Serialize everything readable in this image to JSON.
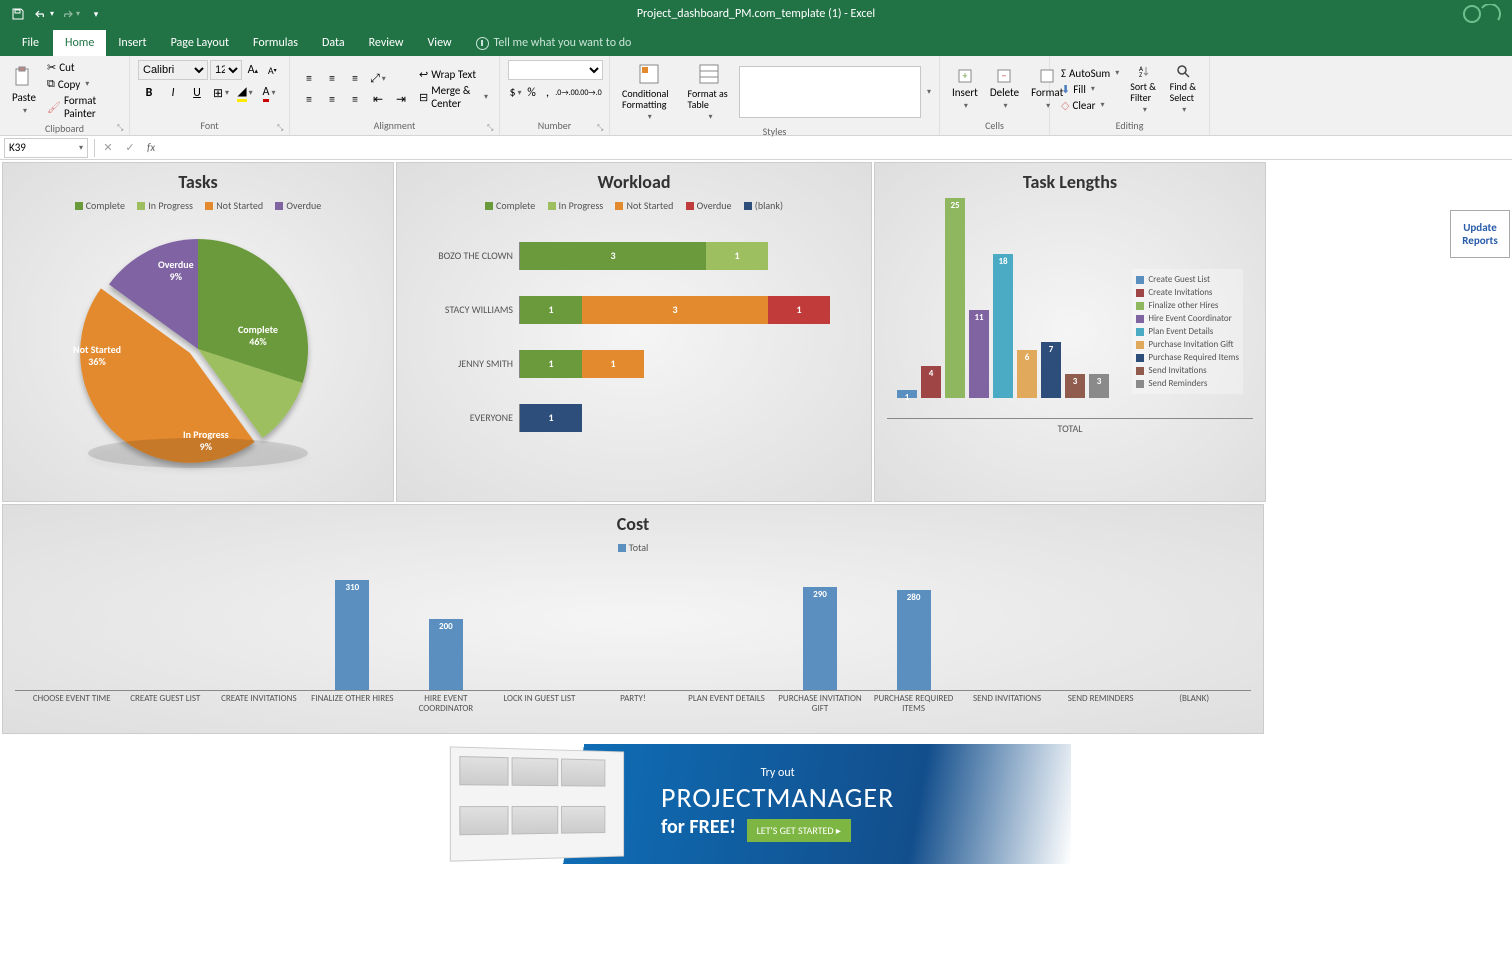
{
  "app": {
    "title": "Project_dashboard_PM.com_template (1) - Excel"
  },
  "tabs": [
    "File",
    "Home",
    "Insert",
    "Page Layout",
    "Formulas",
    "Data",
    "Review",
    "View"
  ],
  "tellme": "Tell me what you want to do",
  "ribbon": {
    "clipboard": {
      "label": "Clipboard",
      "paste": "Paste",
      "cut": "Cut",
      "copy": "Copy",
      "painter": "Format Painter"
    },
    "font": {
      "label": "Font",
      "name": "Calibri",
      "size": "12",
      "bold": "B",
      "italic": "I",
      "underline": "U"
    },
    "alignment": {
      "label": "Alignment",
      "wrap": "Wrap Text",
      "merge": "Merge & Center"
    },
    "number": {
      "label": "Number"
    },
    "styles": {
      "label": "Styles",
      "conditional": "Conditional Formatting",
      "table": "Format as Table"
    },
    "cells": {
      "label": "Cells",
      "insert": "Insert",
      "delete": "Delete",
      "format": "Format"
    },
    "editing": {
      "label": "Editing",
      "autosum": "AutoSum",
      "fill": "Fill",
      "clear": "Clear",
      "sort": "Sort & Filter",
      "find": "Find & Select"
    }
  },
  "formula": {
    "cell": "K39"
  },
  "update_btn": "Update Reports",
  "chart_data": [
    {
      "type": "pie",
      "title": "Tasks",
      "series": [
        {
          "name": "Complete",
          "value": 46,
          "color": "#6a9a3b"
        },
        {
          "name": "In Progress",
          "value": 9,
          "color": "#9dbf5f"
        },
        {
          "name": "Not Started",
          "value": 36,
          "color": "#e38a2f"
        },
        {
          "name": "Overdue",
          "value": 9,
          "color": "#8064a2"
        }
      ]
    },
    {
      "type": "bar",
      "title": "Workload",
      "orientation": "horizontal",
      "legend": [
        "Complete",
        "In Progress",
        "Not Started",
        "Overdue",
        "(blank)"
      ],
      "categories": [
        "BOZO THE CLOWN",
        "STACY WILLIAMS",
        "JENNY SMITH",
        "EVERYONE"
      ],
      "series": [
        {
          "name": "Complete",
          "color": "#6a9a3b",
          "values": [
            3,
            1,
            1,
            0
          ]
        },
        {
          "name": "In Progress",
          "color": "#9dbf5f",
          "values": [
            1,
            0,
            0,
            0
          ]
        },
        {
          "name": "Not Started",
          "color": "#e38a2f",
          "values": [
            0,
            3,
            1,
            0
          ]
        },
        {
          "name": "Overdue",
          "color": "#c23b3b",
          "values": [
            0,
            1,
            0,
            0
          ]
        },
        {
          "name": "(blank)",
          "color": "#2d4e7a",
          "values": [
            0,
            0,
            0,
            1
          ]
        }
      ]
    },
    {
      "type": "bar",
      "title": "Task Lengths",
      "xlabel": "TOTAL",
      "categories": [
        "Create Guest List",
        "Create Invitations",
        "Finalize other Hires",
        "Hire Event Coordinator",
        "Plan Event Details",
        "Purchase Invitation Gift",
        "Purchase Required Items",
        "Send Invitations",
        "Send Reminders"
      ],
      "values": [
        1,
        4,
        25,
        11,
        18,
        6,
        7,
        3,
        3
      ],
      "colors": [
        "#5b8fc0",
        "#a04545",
        "#8fb760",
        "#8064a2",
        "#4babc5",
        "#e0a95c",
        "#2d4e7a",
        "#8f5c4e",
        "#8a8a8a"
      ]
    },
    {
      "type": "bar",
      "title": "Cost",
      "legend": [
        "Total"
      ],
      "categories": [
        "CHOOSE EVENT TIME",
        "CREATE GUEST LIST",
        "CREATE INVITATIONS",
        "FINALIZE OTHER HIRES",
        "HIRE EVENT COORDINATOR",
        "LOCK IN GUEST LIST",
        "PARTY!",
        "PLAN EVENT DETAILS",
        "PURCHASE INVITATION GIFT",
        "PURCHASE REQUIRED ITEMS",
        "SEND INVITATIONS",
        "SEND REMINDERS",
        "(BLANK)"
      ],
      "values": [
        0,
        0,
        0,
        310,
        200,
        0,
        0,
        0,
        290,
        280,
        0,
        0,
        0
      ]
    }
  ],
  "banner": {
    "tryout": "Try out",
    "name1": "PROJECT",
    "name2": "MANAGER",
    "free": "for FREE!",
    "cta": "LET'S GET STARTED",
    "arrow": "▸"
  }
}
